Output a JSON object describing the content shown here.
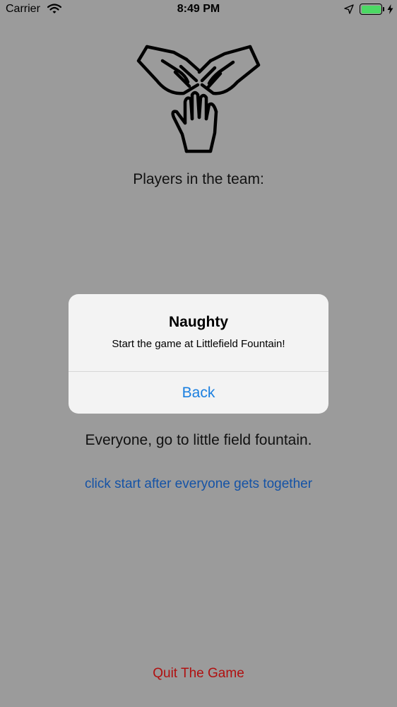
{
  "status_bar": {
    "carrier": "Carrier",
    "time": "8:49 PM",
    "battery_level_percent": 100,
    "charging": true
  },
  "logo": {
    "icon": "team-hands-icon"
  },
  "players_label": "Players in the team:",
  "alert": {
    "title": "Naughty",
    "message": "Start the game at Littlefield Fountain!",
    "back_label": "Back"
  },
  "instructions": {
    "meeting_text": "Everyone, go to little field fountain.",
    "start_link": "click start after everyone gets together"
  },
  "quit_label": "Quit The Game",
  "colors": {
    "dimmed_background": "#9b9b9b",
    "alert_background": "#f3f3f3",
    "alert_button": "#1a7fe0",
    "link_blue": "#1553a6",
    "quit_red": "#b01010",
    "battery_green": "#4cd964"
  }
}
